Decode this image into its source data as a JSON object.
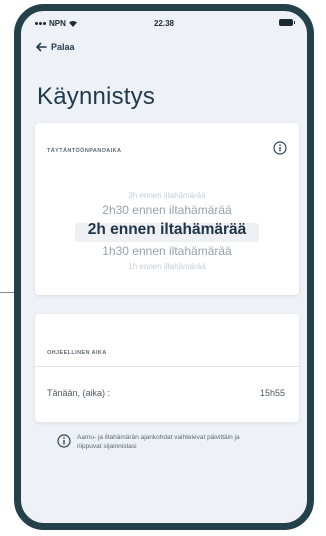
{
  "status": {
    "carrier": "NPN",
    "time": "22.38"
  },
  "nav": {
    "back_label": "Palaa"
  },
  "page": {
    "title": "Käynnistys"
  },
  "start_card": {
    "section_label": "TÄYTÄNTÖÖNPANOAIKA",
    "picker_options": [
      "3h ennen iltahämärää",
      "2h30 ennen iltahämärää",
      "2h ennen iltahämärää",
      "1h30 ennen iltahämärää",
      "1h ennen iltahämärää"
    ],
    "selected_index": 2
  },
  "setting_card": {
    "section_label": "OHJEELLINEN AIKA",
    "row": {
      "label": "Tänään, (aika) :",
      "value": "15h55"
    }
  },
  "note": {
    "text": "Aamu- ja iltahämärän ajankohdat vaihtelevat päivittäin ja riippuvat sijainnistasi"
  },
  "colors": {
    "frame": "#24404b",
    "background": "#eef1f5",
    "title": "#213a4e",
    "selected_text": "#1e3548"
  }
}
